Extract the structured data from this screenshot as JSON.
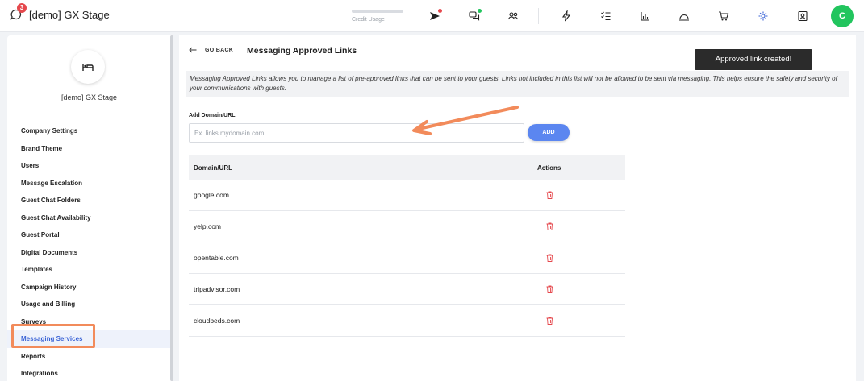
{
  "header": {
    "notification_count": "3",
    "brand_name": "[demo] GX Stage",
    "credit_usage_label": "Credit Usage",
    "credit_usage_fraction": 0,
    "avatar_initial": "C",
    "icons": [
      "send-icon",
      "chat-bubbles-icon",
      "users-icon",
      "lightning-icon",
      "checklist-icon",
      "bar-chart-icon",
      "room-service-icon",
      "cart-icon",
      "gear-icon",
      "contact-badge-icon"
    ]
  },
  "colors": {
    "accent": "#5b86f0",
    "active_menu_text": "#3a63d6",
    "avatar": "#22c55e",
    "badge": "#e5484d",
    "delete": "#e5484d",
    "highlight": "#f28b5b"
  },
  "sidebar": {
    "property_icon": "bed-icon",
    "property_name": "[demo] GX Stage",
    "items": [
      {
        "label": "Company Settings"
      },
      {
        "label": "Brand Theme"
      },
      {
        "label": "Users"
      },
      {
        "label": "Message Escalation"
      },
      {
        "label": "Guest Chat Folders"
      },
      {
        "label": "Guest Chat Availability"
      },
      {
        "label": "Guest Portal"
      },
      {
        "label": "Digital Documents"
      },
      {
        "label": "Templates"
      },
      {
        "label": "Campaign History"
      },
      {
        "label": "Usage and Billing"
      },
      {
        "label": "Surveys"
      },
      {
        "label": "Messaging Services"
      },
      {
        "label": "Reports"
      },
      {
        "label": "Integrations"
      }
    ],
    "active_item": "Messaging Services"
  },
  "main": {
    "go_back_label": "GO BACK",
    "title": "Messaging Approved Links",
    "toast": "Approved link created!",
    "notice": "Messaging Approved Links allows you to manage a list of pre-approved links that can be sent to your guests. Links not included in this list will not be allowed to be sent via messaging. This helps ensure the safety and security of your communications with guests.",
    "field_label": "Add Domain/URL",
    "input_value": "",
    "input_placeholder": "Ex. links.mydomain.com",
    "add_button": "ADD",
    "table": {
      "columns": [
        "Domain/URL",
        "Actions"
      ],
      "rows": [
        {
          "domain": "google.com"
        },
        {
          "domain": "yelp.com"
        },
        {
          "domain": "opentable.com"
        },
        {
          "domain": "tripadvisor.com"
        },
        {
          "domain": "cloudbeds.com"
        }
      ],
      "row_action_icon": "trash-icon"
    }
  }
}
